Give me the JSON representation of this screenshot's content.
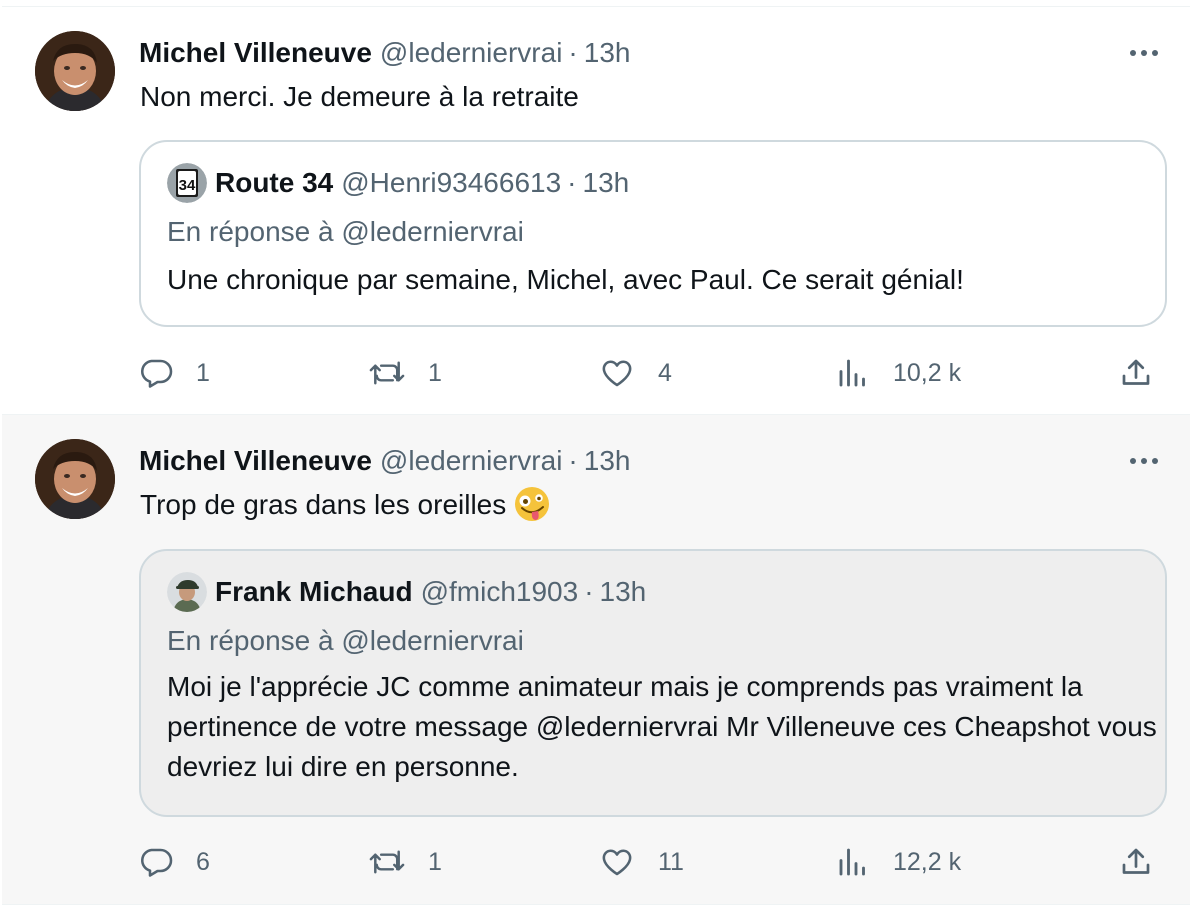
{
  "colors": {
    "text_primary": "#0f1419",
    "text_secondary": "#536471",
    "border": "#cfd9de"
  },
  "tweets": [
    {
      "author": {
        "name": "Michel Villeneuve",
        "handle": "@ledernier​vrai"
      },
      "separator": "·",
      "time": "13h",
      "text": "Non merci.  Je demeure à la retraite",
      "emoji": "",
      "quote": {
        "author": {
          "name": "Route 34",
          "handle": "@Henri93466613",
          "avatar_icon": "route-34-sign-icon"
        },
        "separator": "·",
        "time": "13h",
        "reply_to": "En réponse à @ledernier​vrai",
        "text": "Une chronique par semaine, Michel, avec Paul. Ce serait génial!"
      },
      "stats": {
        "replies": "1",
        "retweets": "1",
        "likes": "4",
        "views": "10,2 k"
      }
    },
    {
      "author": {
        "name": "Michel Villeneuve",
        "handle": "@ledernier​vrai"
      },
      "separator": "·",
      "time": "13h",
      "text": "Trop de gras dans les oreilles",
      "emoji": "zany-face-icon",
      "quote": {
        "author": {
          "name": "Frank Michaud",
          "handle": "@fmich1903",
          "avatar_icon": "avatar-photo"
        },
        "separator": "·",
        "time": "13h",
        "reply_to": "En réponse à @ledernier​vrai",
        "text": "Moi je l'apprécie JC comme animateur mais je comprends pas vraiment la pertinence de votre message @ledernier​vrai Mr Villeneuve ces Cheapshot  vous devriez lui dire en personne."
      },
      "stats": {
        "replies": "6",
        "retweets": "1",
        "likes": "11",
        "views": "12,2 k"
      }
    }
  ]
}
